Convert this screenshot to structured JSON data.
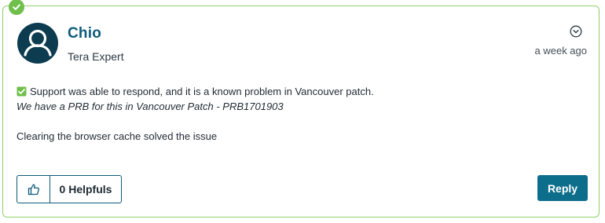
{
  "post": {
    "author": {
      "name": "Chio",
      "rank": "Tera Expert"
    },
    "timestamp": "a week ago",
    "body": {
      "line1": "Support was able to respond, and it is a known problem in Vancouver patch.",
      "line2": "We have a PRB for this in Vancouver Patch - PRB1701903",
      "line3": "Clearing the browser cache solved the issue"
    },
    "helpfuls_label": "0 Helpfuls",
    "reply_label": "Reply"
  },
  "icons": {
    "solution": "checkmark-icon",
    "avatar": "user-avatar-icon",
    "options": "chevron-down-circle-icon",
    "inline_check": "checkbox-checked-icon",
    "helpful": "thumbs-up-icon"
  },
  "colors": {
    "accent_green": "#6fbf4a",
    "card_border": "#8fcf6d",
    "brand_blue": "#0d5a7a",
    "reply_button": "#0d6e8c",
    "avatar_bg": "#0d3b4f"
  }
}
